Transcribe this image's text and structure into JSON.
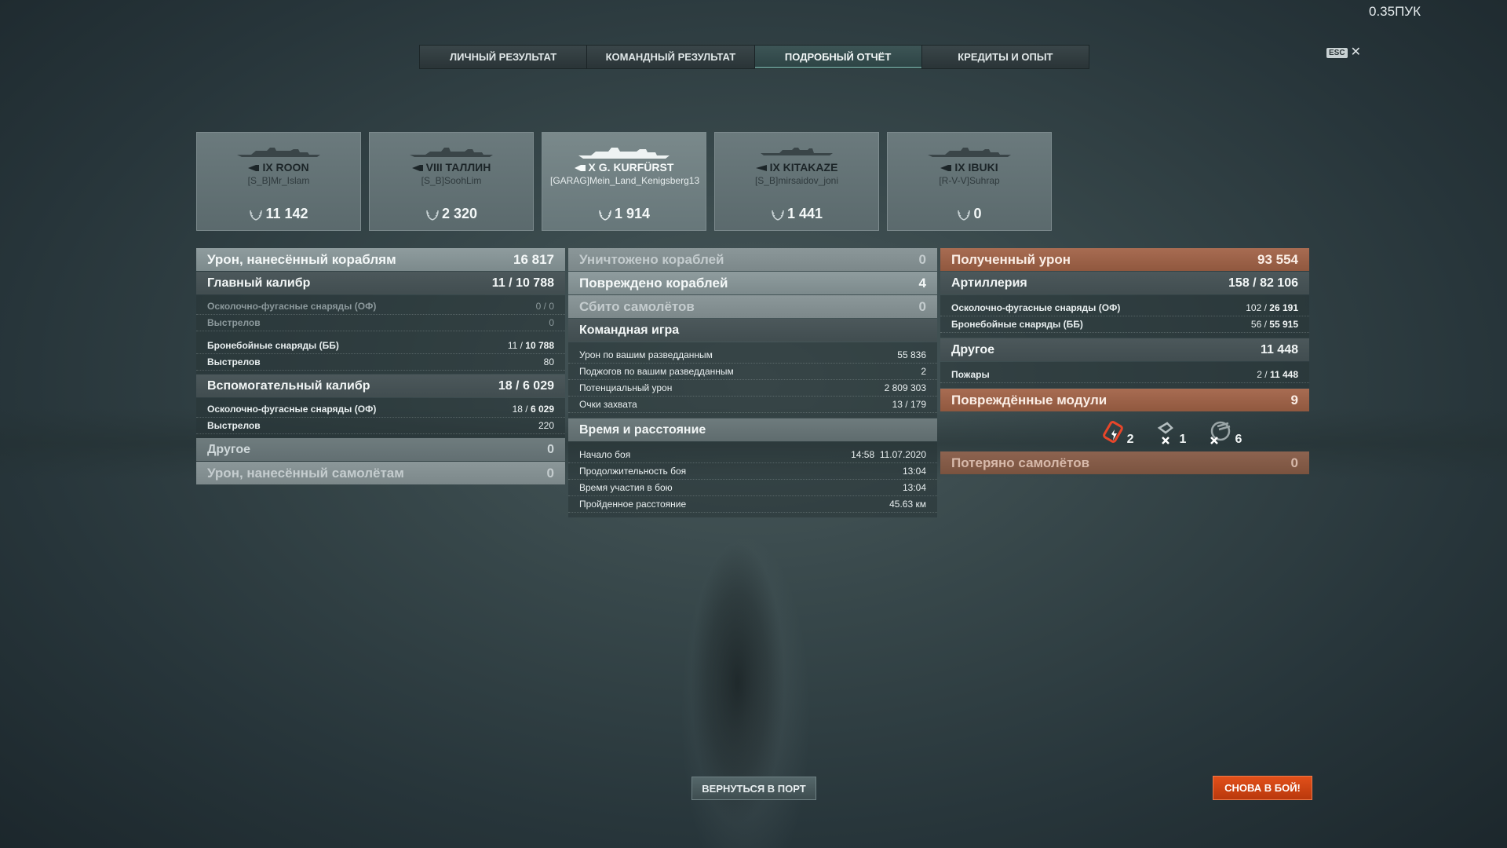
{
  "version": "0.35ПУК",
  "esc_label": "ESC",
  "tabs": [
    {
      "label": "ЛИЧНЫЙ РЕЗУЛЬТАТ"
    },
    {
      "label": "КОМАНДНЫЙ РЕЗУЛЬТАТ"
    },
    {
      "label": "ПОДРОБНЫЙ ОТЧЁТ",
      "active": true
    },
    {
      "label": "КРЕДИТЫ И ОПЫТ"
    }
  ],
  "cards": [
    {
      "ship": "IX ROON",
      "player": "[S_B]Mr_Islam",
      "score": "11 142"
    },
    {
      "ship": "VIII ТАЛЛИН",
      "player": "[S_B]SoohLim",
      "score": "2 320"
    },
    {
      "ship": "X G. KURFÜRST",
      "player": "[GARAG]Mein_Land_Kenigsberg13",
      "score": "1 914"
    },
    {
      "ship": "IX KITAKAZE",
      "player": "[S_B]mirsaidov_joni",
      "score": "1 441"
    },
    {
      "ship": "IX IBUKI",
      "player": "[R-V-V]Suhrap",
      "score": "0"
    }
  ],
  "left": {
    "damage": {
      "label": "Урон, нанесённый кораблям",
      "value": "16 817"
    },
    "main": {
      "label": "Главный калибр",
      "hits": "11",
      "value": "10 788"
    },
    "main_he": {
      "label": "Осколочно-фугасные снаряды (ОФ)",
      "value": "0 / 0"
    },
    "main_he_shots": {
      "label": "Выстрелов",
      "value": "0"
    },
    "main_ap": {
      "label": "Бронебойные снаряды (ББ)",
      "hits": "11",
      "value": "10 788"
    },
    "main_ap_shots": {
      "label": "Выстрелов",
      "value": "80"
    },
    "sec": {
      "label": "Вспомогательный калибр",
      "hits": "18",
      "value": "6 029"
    },
    "sec_he": {
      "label": "Осколочно-фугасные снаряды (ОФ)",
      "hits": "18",
      "value": "6 029"
    },
    "sec_shots": {
      "label": "Выстрелов",
      "value": "220"
    },
    "other": {
      "label": "Другое",
      "value": "0"
    },
    "planes": {
      "label": "Урон, нанесённый самолётам",
      "value": "0"
    }
  },
  "mid": {
    "destroyed": {
      "label": "Уничтожено кораблей",
      "value": "0"
    },
    "damaged": {
      "label": "Повреждено кораблей",
      "value": "4"
    },
    "shot_planes": {
      "label": "Сбито самолётов",
      "value": "0"
    },
    "team": {
      "label": "Командная игра"
    },
    "spot_dmg": {
      "label": "Урон по вашим разведданным",
      "value": "55 836"
    },
    "spot_fires": {
      "label": "Поджогов по вашим разведданным",
      "value": "2"
    },
    "potential": {
      "label": "Потенциальный урон",
      "value": "2 809 303"
    },
    "capture": {
      "label": "Очки захвата",
      "value": "13 / 179"
    },
    "time": {
      "label": "Время и расстояние"
    },
    "start": {
      "label": "Начало боя",
      "value": "14:58  11.07.2020"
    },
    "duration": {
      "label": "Продолжительность боя",
      "value": "13:04"
    },
    "participation": {
      "label": "Время участия в бою",
      "value": "13:04"
    },
    "distance": {
      "label": "Пройденное расстояние",
      "value": "45.63 км"
    }
  },
  "right": {
    "received": {
      "label": "Полученный урон",
      "value": "93 554"
    },
    "artillery": {
      "label": "Артиллерия",
      "hits": "158",
      "value": "82 106"
    },
    "art_he": {
      "label": "Осколочно-фугасные снаряды (ОФ)",
      "hits": "102",
      "value": "26 191"
    },
    "art_ap": {
      "label": "Бронебойные снаряды (ББ)",
      "hits": "56",
      "value": "55 915"
    },
    "other": {
      "label": "Другое",
      "value": "11 448"
    },
    "fires": {
      "label": "Пожары",
      "hits": "2",
      "value": "11 448"
    },
    "modules": {
      "label": "Повреждённые модули",
      "value": "9"
    },
    "mod_icons": [
      {
        "icon": "engine-icon",
        "count": "2"
      },
      {
        "icon": "steering-icon",
        "count": "1"
      },
      {
        "icon": "turret-icon",
        "count": "6"
      }
    ],
    "lost_planes": {
      "label": "Потеряно самолётов",
      "value": "0"
    }
  },
  "buttons": {
    "port": "ВЕРНУТЬСЯ В ПОРТ",
    "battle": "СНОВА В БОЙ!"
  },
  "colors": {
    "accent_orange": "#d94a16",
    "received_orange": "#a86c52",
    "panel_grey": "#8f9c9e"
  }
}
